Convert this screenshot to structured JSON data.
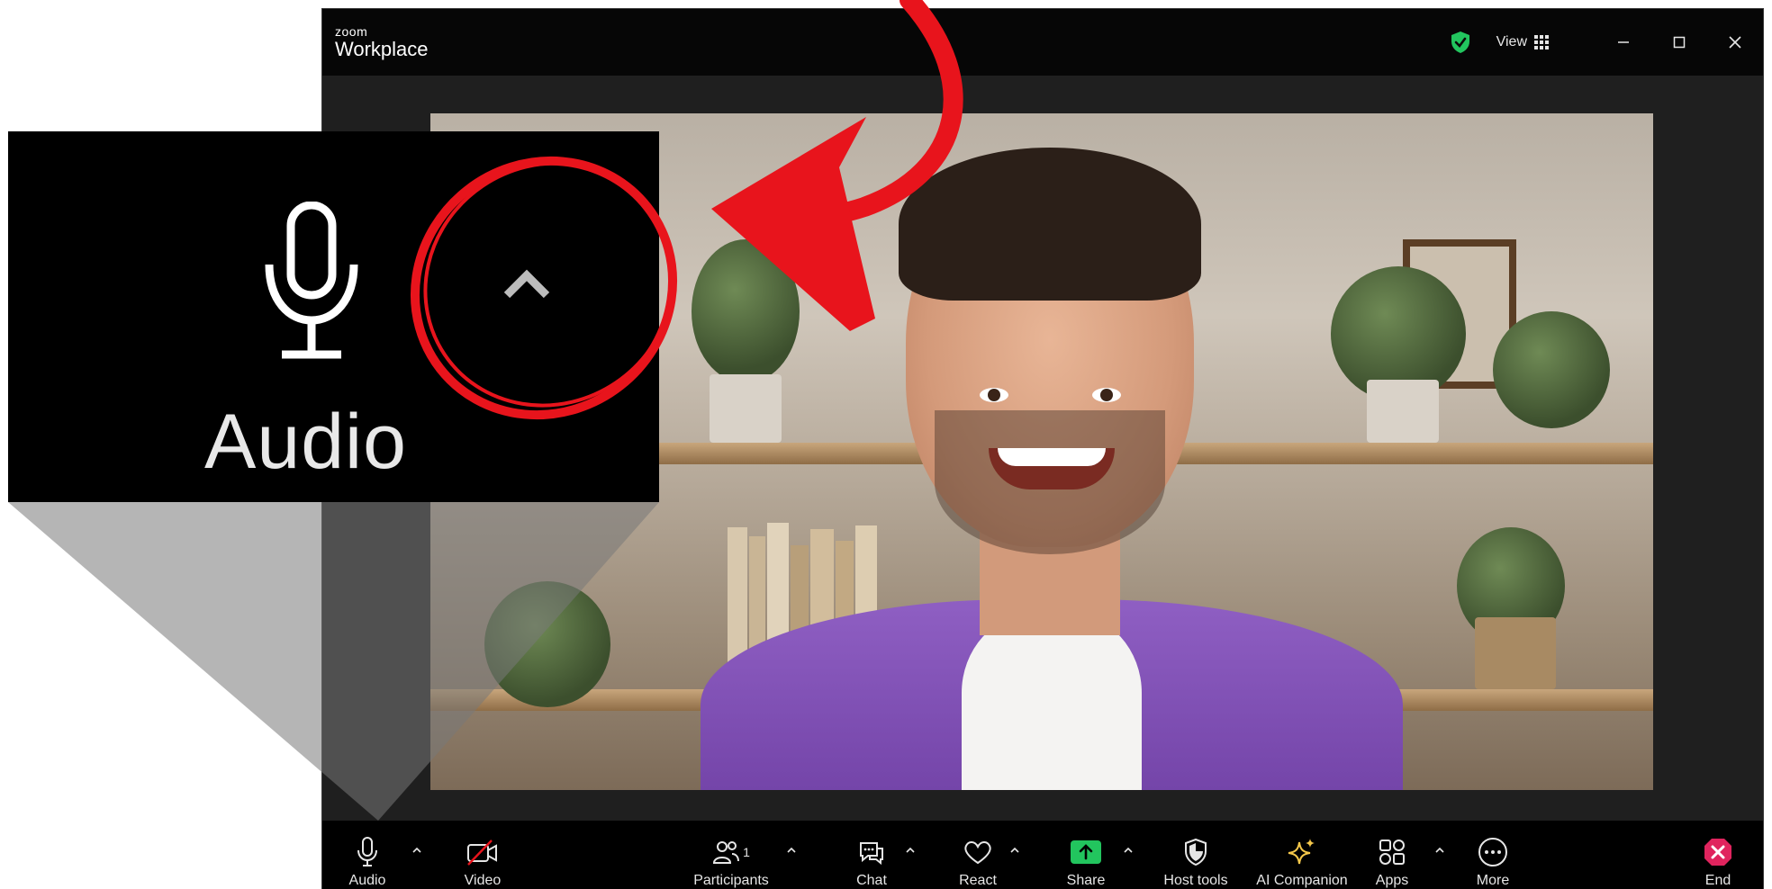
{
  "titlebar": {
    "logo_small": "zoom",
    "logo_big": "Workplace",
    "view_label": "View",
    "security_color": "#22c55e"
  },
  "toolbar": {
    "audio_label": "Audio",
    "video_label": "Video",
    "participants_label": "Participants",
    "participants_count": "1",
    "chat_label": "Chat",
    "react_label": "React",
    "share_label": "Share",
    "host_tools_label": "Host tools",
    "ai_companion_label": "AI Companion",
    "apps_label": "Apps",
    "more_label": "More",
    "end_label": "End",
    "share_color": "#22c55e",
    "end_color": "#e0245e",
    "ai_color": "#f5c84b"
  },
  "callout": {
    "label": "Audio",
    "annotation_color": "#e8141c"
  }
}
